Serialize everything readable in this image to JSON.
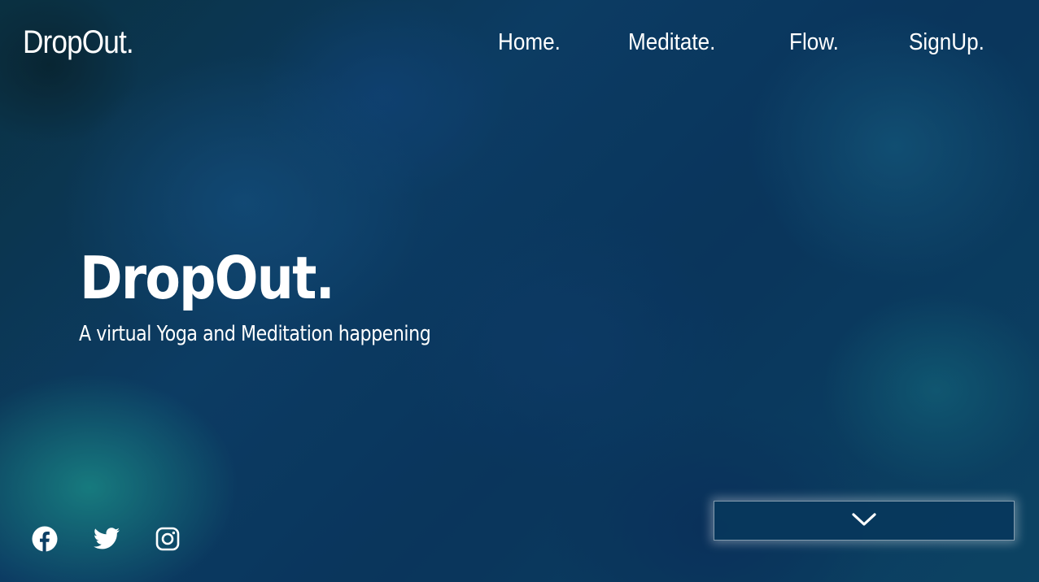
{
  "brand": {
    "name": "DropOut."
  },
  "nav": {
    "items": [
      {
        "label": "Home."
      },
      {
        "label": "Meditate."
      },
      {
        "label": "Flow."
      },
      {
        "label": "SignUp."
      }
    ]
  },
  "hero": {
    "title": "DropOut.",
    "subtitle": "A virtual Yoga and Meditation happening"
  },
  "social": {
    "icons": [
      "facebook-icon",
      "twitter-icon",
      "instagram-icon"
    ]
  },
  "scroll_button": {
    "icon": "chevron-down-icon"
  },
  "colors": {
    "text": "#ffffff",
    "background": "#0f4876",
    "accent": "#20aaa0"
  }
}
